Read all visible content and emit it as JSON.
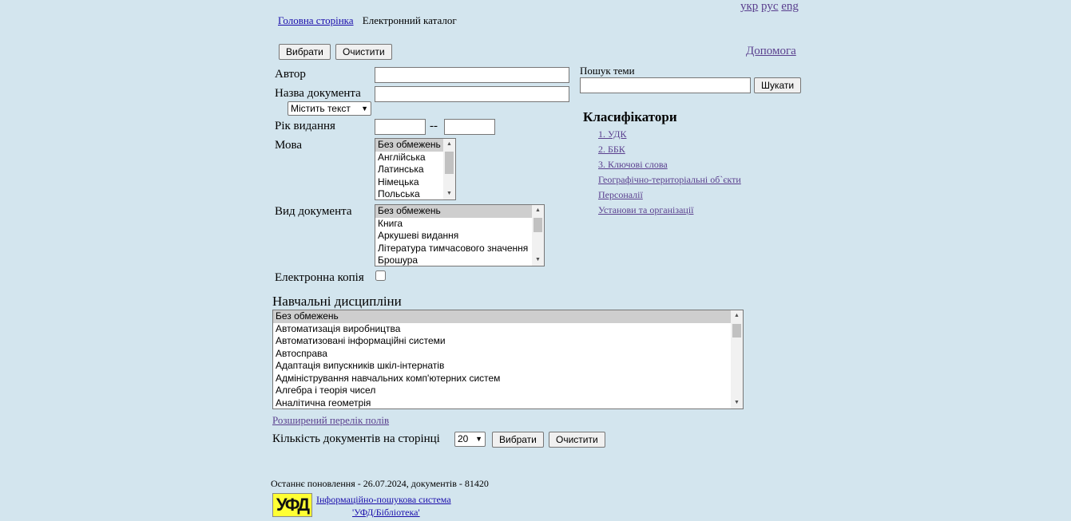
{
  "languages": [
    "укр",
    "рус",
    "eng"
  ],
  "breadcrumb": {
    "home": "Головна сторінка",
    "current": "Електронний каталог"
  },
  "toolbar": {
    "select_label": "Вибрати",
    "clear_label": "Очистити",
    "help_label": "Допомога"
  },
  "form": {
    "author_label": "Автор",
    "title_label": "Назва документа",
    "title_mode": "Містить текст",
    "year_label": "Рік видання",
    "year_sep": "--",
    "language_label": "Мова",
    "language_options": [
      "Без обмежень",
      "Англійська",
      "Латинська",
      "Німецька",
      "Польська"
    ],
    "doctype_label": "Вид документа",
    "doctype_options": [
      "Без обмежень",
      "Книга",
      "Аркушеві видання",
      "Література тимчасового значення",
      "Брошура"
    ],
    "ecopy_label": "Електронна копія",
    "disciplines_label": "Навчальні дисципліни",
    "discipline_options": [
      "Без обмежень",
      "Автоматизація виробництва",
      "Автоматизовані інформаційні системи",
      "Автосправа",
      "Адаптація випускників шкіл-інтернатів",
      "Адміністрування навчальних комп'ютерних систем",
      "Алгебра і теорія чисел",
      "Аналітична геометрія"
    ],
    "extended_link": "Розширений перелік полів",
    "per_page_label": "Кількість документів на сторінці",
    "per_page_value": "20"
  },
  "topic_search": {
    "label": "Пошук теми",
    "button": "Шукати"
  },
  "classifiers": {
    "title": "Класифікатори",
    "items": [
      "1. УДК",
      "2. ББК",
      "3. Ключові слова",
      "Географічно-територіальні об`єкти",
      "Персоналії",
      "Установи та організації"
    ]
  },
  "footer": {
    "update": "Останнє поновлення - 26.07.2024, документів - 81420",
    "logo_text": "УФД",
    "system_line1": "Інформаційно-пошукова система",
    "system_line2": "'УФД/Бібліотека'"
  }
}
